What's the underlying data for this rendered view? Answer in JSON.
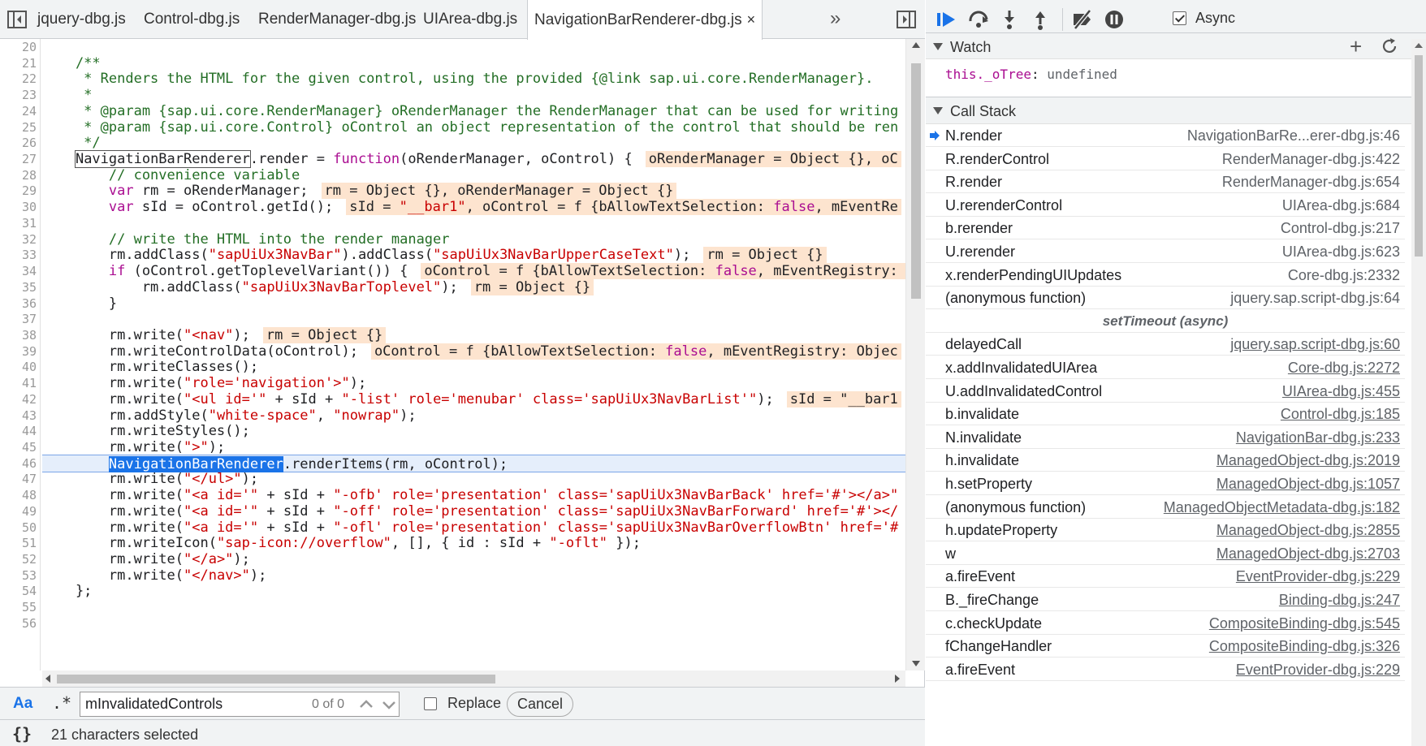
{
  "editor": {
    "tabs": [
      {
        "label": "jquery-dbg.js"
      },
      {
        "label": "Control-dbg.js"
      },
      {
        "label": "RenderManager-dbg.js"
      },
      {
        "label": "UIArea-dbg.js"
      },
      {
        "label": "NavigationBarRenderer-dbg.js",
        "active": true
      }
    ],
    "tab_close": "×",
    "tab_overflow": "»",
    "line_numbers": [
      "20",
      "21",
      "22",
      "23",
      "24",
      "25",
      "26",
      "27",
      "28",
      "29",
      "30",
      "31",
      "32",
      "33",
      "34",
      "35",
      "36",
      "37",
      "38",
      "39",
      "40",
      "41",
      "42",
      "43",
      "44",
      "45",
      "46",
      "47",
      "48",
      "49",
      "50",
      "51",
      "52",
      "53",
      "54",
      "55",
      "56"
    ],
    "execution_line_index": 26,
    "lines": [
      [],
      [
        [
          "cm",
          "    /**"
        ]
      ],
      [
        [
          "cm",
          "     * Renders the HTML for the given control, using the provided {@link sap.ui.core.RenderManager}."
        ]
      ],
      [
        [
          "cm",
          "     *"
        ]
      ],
      [
        [
          "cm",
          "     * @param {sap.ui.core.RenderManager} oRenderManager the RenderManager that can be used for writing"
        ]
      ],
      [
        [
          "cm",
          "     * @param {sap.ui.core.Control} oControl an object representation of the control that should be ren"
        ]
      ],
      [
        [
          "cm",
          "     */"
        ]
      ],
      [
        [
          "plain",
          "    "
        ],
        [
          "boxed",
          "NavigationBarRenderer"
        ],
        [
          "plain",
          ".render = "
        ],
        [
          "kw",
          "function"
        ],
        [
          "plain",
          "(oRenderManager, oControl) {"
        ],
        [
          "inline",
          "oRenderManager = Object {}, oC"
        ]
      ],
      [
        [
          "cm",
          "        // convenience variable"
        ]
      ],
      [
        [
          "plain",
          "        "
        ],
        [
          "kw",
          "var"
        ],
        [
          "plain",
          " rm = oRenderManager;"
        ],
        [
          "inline",
          "rm = Object {}, oRenderManager = Object {}"
        ]
      ],
      [
        [
          "plain",
          "        "
        ],
        [
          "kw",
          "var"
        ],
        [
          "plain",
          " sId = oControl.getId();"
        ],
        [
          "inline",
          "sId = \"__bar1\", oControl = f {bAllowTextSelection: false, mEventRe"
        ]
      ],
      [],
      [
        [
          "cm",
          "        // write the HTML into the render manager"
        ]
      ],
      [
        [
          "plain",
          "        rm.addClass("
        ],
        [
          "str",
          "\"sapUiUx3NavBar\""
        ],
        [
          "plain",
          ").addClass("
        ],
        [
          "str",
          "\"sapUiUx3NavBarUpperCaseText\""
        ],
        [
          "plain",
          ");"
        ],
        [
          "inline",
          "rm = Object {}"
        ]
      ],
      [
        [
          "plain",
          "        "
        ],
        [
          "kw",
          "if"
        ],
        [
          "plain",
          " (oControl.getToplevelVariant()) {"
        ],
        [
          "inline",
          "oControl = f {bAllowTextSelection: false, mEventRegistry: "
        ]
      ],
      [
        [
          "plain",
          "            rm.addClass("
        ],
        [
          "str",
          "\"sapUiUx3NavBarToplevel\""
        ],
        [
          "plain",
          ");"
        ],
        [
          "inline",
          "rm = Object {}"
        ]
      ],
      [
        [
          "plain",
          "        }"
        ]
      ],
      [],
      [
        [
          "plain",
          "        rm.write("
        ],
        [
          "str",
          "\"<nav\""
        ],
        [
          "plain",
          ");"
        ],
        [
          "inline",
          "rm = Object {}"
        ]
      ],
      [
        [
          "plain",
          "        rm.writeControlData(oControl);"
        ],
        [
          "inline",
          "oControl = f {bAllowTextSelection: false, mEventRegistry: Objec"
        ]
      ],
      [
        [
          "plain",
          "        rm.writeClasses();"
        ]
      ],
      [
        [
          "plain",
          "        rm.write("
        ],
        [
          "str",
          "\"role='navigation'>\""
        ],
        [
          "plain",
          ");"
        ]
      ],
      [
        [
          "plain",
          "        rm.write("
        ],
        [
          "str",
          "\"<ul id='\""
        ],
        [
          "plain",
          " + sId + "
        ],
        [
          "str",
          "\"-list' role='menubar' class='sapUiUx3NavBarList'\""
        ],
        [
          "plain",
          ");"
        ],
        [
          "inline",
          "sId = \"__bar1"
        ]
      ],
      [
        [
          "plain",
          "        rm.addStyle("
        ],
        [
          "str",
          "\"white-space\""
        ],
        [
          "plain",
          ", "
        ],
        [
          "str",
          "\"nowrap\""
        ],
        [
          "plain",
          ");"
        ]
      ],
      [
        [
          "plain",
          "        rm.writeStyles();"
        ]
      ],
      [
        [
          "plain",
          "        rm.write("
        ],
        [
          "str",
          "\">\""
        ],
        [
          "plain",
          ");"
        ]
      ],
      [
        [
          "plain",
          "        "
        ],
        [
          "sel",
          "NavigationBarRenderer"
        ],
        [
          "plain",
          ".renderItems(rm, oControl);"
        ]
      ],
      [
        [
          "plain",
          "        rm.write("
        ],
        [
          "str",
          "\"</ul>\""
        ],
        [
          "plain",
          ");"
        ]
      ],
      [
        [
          "plain",
          "        rm.write("
        ],
        [
          "str",
          "\"<a id='\""
        ],
        [
          "plain",
          " + sId + "
        ],
        [
          "str",
          "\"-ofb' role='presentation' class='sapUiUx3NavBarBack' href='#'></a>\""
        ]
      ],
      [
        [
          "plain",
          "        rm.write("
        ],
        [
          "str",
          "\"<a id='\""
        ],
        [
          "plain",
          " + sId + "
        ],
        [
          "str",
          "\"-off' role='presentation' class='sapUiUx3NavBarForward' href='#'></"
        ]
      ],
      [
        [
          "plain",
          "        rm.write("
        ],
        [
          "str",
          "\"<a id='\""
        ],
        [
          "plain",
          " + sId + "
        ],
        [
          "str",
          "\"-ofl' role='presentation' class='sapUiUx3NavBarOverflowBtn' href='#"
        ]
      ],
      [
        [
          "plain",
          "        rm.writeIcon("
        ],
        [
          "str",
          "\"sap-icon://overflow\""
        ],
        [
          "plain",
          ", [], { id : sId + "
        ],
        [
          "str",
          "\"-oflt\""
        ],
        [
          "plain",
          " });"
        ]
      ],
      [
        [
          "plain",
          "        rm.write("
        ],
        [
          "str",
          "\"</a>\""
        ],
        [
          "plain",
          ");"
        ]
      ],
      [
        [
          "plain",
          "        rm.write("
        ],
        [
          "str",
          "\"</nav>\""
        ],
        [
          "plain",
          ");"
        ]
      ],
      [
        [
          "plain",
          "    };"
        ]
      ],
      [],
      []
    ]
  },
  "search": {
    "case_label": "Aa",
    "regex_label": ".*",
    "value": "mInvalidatedControls",
    "count": "0 of 0",
    "replace_label": "Replace",
    "cancel_label": "Cancel"
  },
  "status": {
    "braces": "{}",
    "text": "21 characters selected"
  },
  "debugger": {
    "async_label": "Async",
    "watch": {
      "title": "Watch",
      "add": "+",
      "expressions": [
        {
          "name": "this._oTree",
          "sep": ": ",
          "value": "undefined"
        }
      ]
    },
    "call_stack": {
      "title": "Call Stack",
      "frames": [
        {
          "name": "N.render",
          "loc": "NavigationBarRe...erer-dbg.js:46",
          "current": true,
          "link": false
        },
        {
          "name": "R.renderControl",
          "loc": "RenderManager-dbg.js:422",
          "link": false
        },
        {
          "name": "R.render",
          "loc": "RenderManager-dbg.js:654",
          "link": false
        },
        {
          "name": "U.rerenderControl",
          "loc": "UIArea-dbg.js:684",
          "link": false
        },
        {
          "name": "b.rerender",
          "loc": "Control-dbg.js:217",
          "link": false
        },
        {
          "name": "U.rerender",
          "loc": "UIArea-dbg.js:623",
          "link": false
        },
        {
          "name": "x.renderPendingUIUpdates",
          "loc": "Core-dbg.js:2332",
          "link": false
        },
        {
          "name": "(anonymous function)",
          "loc": "jquery.sap.script-dbg.js:64",
          "link": false
        },
        {
          "separator": "setTimeout (async)"
        },
        {
          "name": "delayedCall",
          "loc": "jquery.sap.script-dbg.js:60",
          "link": true
        },
        {
          "name": "x.addInvalidatedUIArea",
          "loc": "Core-dbg.js:2272",
          "link": true
        },
        {
          "name": "U.addInvalidatedControl",
          "loc": "UIArea-dbg.js:455",
          "link": true
        },
        {
          "name": "b.invalidate",
          "loc": "Control-dbg.js:185",
          "link": true
        },
        {
          "name": "N.invalidate",
          "loc": "NavigationBar-dbg.js:233",
          "link": true
        },
        {
          "name": "h.invalidate",
          "loc": "ManagedObject-dbg.js:2019",
          "link": true
        },
        {
          "name": "h.setProperty",
          "loc": "ManagedObject-dbg.js:1057",
          "link": true
        },
        {
          "name": "(anonymous function)",
          "loc": "ManagedObjectMetadata-dbg.js:182",
          "link": true
        },
        {
          "name": "h.updateProperty",
          "loc": "ManagedObject-dbg.js:2855",
          "link": true
        },
        {
          "name": "w",
          "loc": "ManagedObject-dbg.js:2703",
          "link": true
        },
        {
          "name": "a.fireEvent",
          "loc": "EventProvider-dbg.js:229",
          "link": true
        },
        {
          "name": "B._fireChange",
          "loc": "Binding-dbg.js:247",
          "link": true
        },
        {
          "name": "c.checkUpdate",
          "loc": "CompositeBinding-dbg.js:545",
          "link": true
        },
        {
          "name": "fChangeHandler",
          "loc": "CompositeBinding-dbg.js:326",
          "link": true
        },
        {
          "name": "a.fireEvent",
          "loc": "EventProvider-dbg.js:229",
          "link": true
        }
      ]
    }
  },
  "colors": {
    "accent": "#1a73e8",
    "comment": "#236e25",
    "keyword": "#aa0d91",
    "string": "#c80000",
    "inline_value_bg": "#fde4cf"
  }
}
